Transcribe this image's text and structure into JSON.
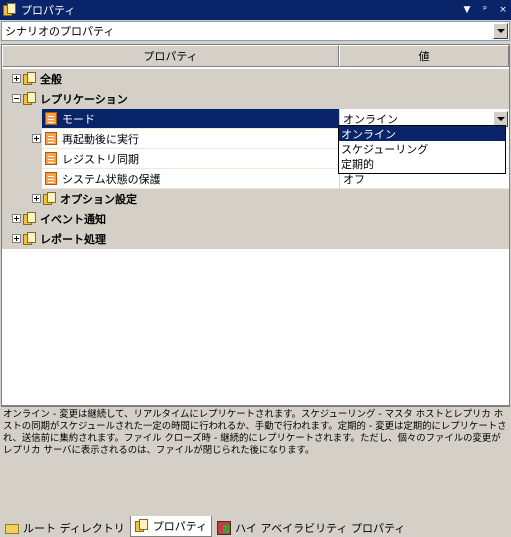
{
  "window": {
    "title": "プロパティ",
    "controls": [
      "▼",
      "ᵖ",
      "×"
    ]
  },
  "scenario_select": {
    "value": "シナリオのプロパティ"
  },
  "grid": {
    "header_property": "プロパティ",
    "header_value": "値",
    "rows": [
      {
        "label": "全般",
        "expander": "plus",
        "icon": "book-icon",
        "bold": true
      },
      {
        "label": "レプリケーション",
        "expander": "minus",
        "icon": "book-icon",
        "bold": true
      },
      {
        "label": "モード",
        "icon": "property-icon",
        "value": "オンライン",
        "selected": true
      },
      {
        "label": "再起動後に実行",
        "expander": "plus",
        "icon": "property-icon",
        "value": ""
      },
      {
        "label": "レジストリ同期",
        "icon": "property-icon",
        "value": ""
      },
      {
        "label": "システム状態の保護",
        "icon": "property-icon",
        "value": "オフ"
      },
      {
        "label": "オプション設定",
        "expander": "plus",
        "icon": "book-icon",
        "bold": true
      },
      {
        "label": "イベント通知",
        "expander": "plus",
        "icon": "book-icon",
        "bold": true
      },
      {
        "label": "レポート処理",
        "expander": "plus",
        "icon": "book-icon",
        "bold": true
      }
    ]
  },
  "mode_dropdown": {
    "options": [
      "オンライン",
      "スケジューリング",
      "定期的"
    ],
    "highlighted": "オンライン"
  },
  "description": "オンライン - 変更は継続して、リアルタイムにレプリケートされます。スケジューリング - マスタ ホストとレプリカ ホストの同期がスケジュールされた一定の時間に行われるか、手動で行われます。定期的 - 変更は定期的にレプリケートされ、送信前に集約されます。ファイル クローズ時 - 継続的にレプリケートされます。ただし、個々のファイルの変更がレプリカ サーバに表示されるのは、ファイルが閉じられた後になります。",
  "tabs": [
    {
      "label": "ルート ディレクトリ",
      "icon": "folder-icon",
      "active": false
    },
    {
      "label": "プロパティ",
      "icon": "properties-icon",
      "active": true
    },
    {
      "label": "ハイ アベイラビリティ プロパティ",
      "icon": "high-availability-icon",
      "active": false
    }
  ]
}
